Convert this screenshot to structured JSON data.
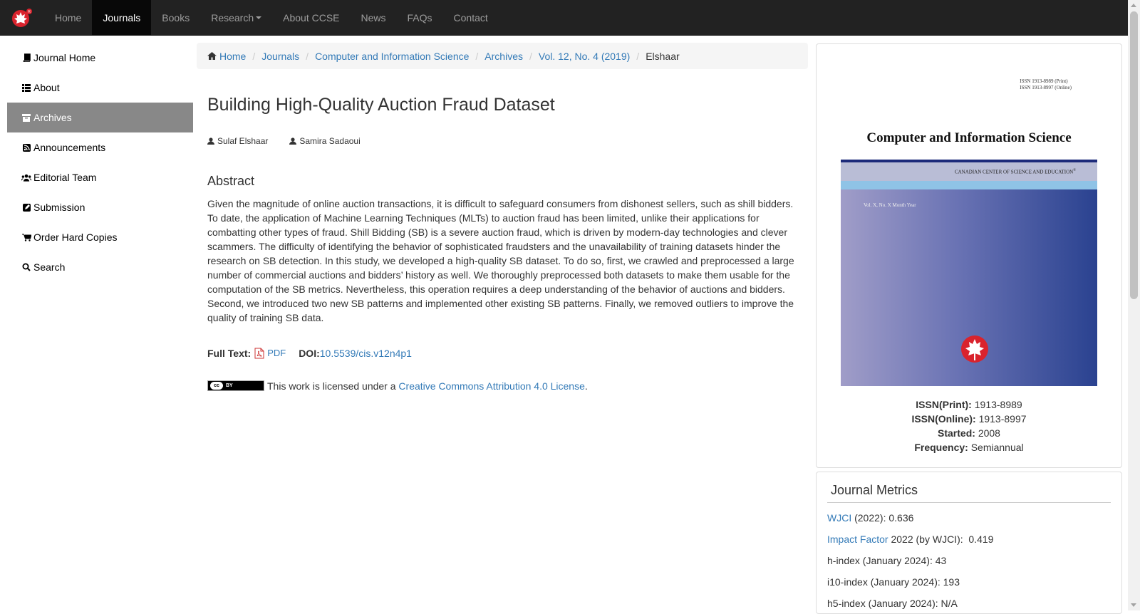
{
  "nav": {
    "items": [
      {
        "label": "Home",
        "active": false
      },
      {
        "label": "Journals",
        "active": true
      },
      {
        "label": "Books",
        "active": false
      },
      {
        "label": "Research",
        "active": false,
        "dropdown": true
      },
      {
        "label": "About CCSE",
        "active": false
      },
      {
        "label": "News",
        "active": false
      },
      {
        "label": "FAQs",
        "active": false
      },
      {
        "label": "Contact",
        "active": false
      }
    ]
  },
  "sidebar": {
    "items": [
      {
        "label": "Journal Home",
        "icon": "book-icon"
      },
      {
        "label": "About",
        "icon": "list-icon"
      },
      {
        "label": "Archives",
        "icon": "archive-icon",
        "active": true
      },
      {
        "label": "Announcements",
        "icon": "rss-icon"
      },
      {
        "label": "Editorial Team",
        "icon": "users-icon"
      },
      {
        "label": "Submission",
        "icon": "edit-icon"
      },
      {
        "label": "Order Hard Copies",
        "icon": "cart-icon"
      },
      {
        "label": "Search",
        "icon": "search-icon"
      }
    ]
  },
  "breadcrumb": {
    "home": "Home",
    "journals": "Journals",
    "journal": "Computer and Information Science",
    "archives": "Archives",
    "issue": "Vol. 12, No. 4 (2019)",
    "current": "Elshaar"
  },
  "article": {
    "title": "Building High-Quality Auction Fraud Dataset",
    "authors": [
      "Sulaf Elshaar",
      "Samira Sadaoui"
    ],
    "abstract_heading": "Abstract",
    "abstract": "Given the magnitude of online auction transactions, it is difficult to safeguard consumers from dishonest sellers, such as shill bidders. To date, the application of Machine Learning Techniques (MLTs) to auction fraud has been limited, unlike their applications for combatting other types of fraud. Shill Bidding (SB) is a severe auction fraud, which is driven by modern-day technologies and clever scammers. The difficulty of identifying the behavior of sophisticated fraudsters and the unavailability of training datasets hinder the research on SB detection. In this study, we developed a high-quality SB dataset. To do so, first, we crawled and preprocessed a large number of commercial auctions and bidders’ history as well. We thoroughly preprocessed both datasets to make them usable for the computation of the SB metrics. Nevertheless, this operation requires a deep understanding of the behavior of auctions and bidders. Second, we introduced two new SB patterns and implemented other existing SB patterns. Finally, we removed outliers to improve the quality of training SB data.",
    "fulltext_label": "Full Text:",
    "pdf_label": "PDF",
    "doi_label": "DOI:",
    "doi_value": "10.5539/cis.v12n4p1",
    "license_prefix": "This work is licensed under a ",
    "license_link": "Creative Commons Attribution 4.0 License",
    "license_suffix": ".",
    "cc_badge_text": "BY"
  },
  "cover": {
    "issn_print_line": "ISSN 1913-8989 (Print)",
    "issn_online_line": "ISSN 1913-8997 (Online)",
    "title": "Computer and Information Science",
    "org": "CANADIAN CENTER OF SCIENCE AND EDUCATION",
    "vol_line": "Vol. X, No. X  Month Year"
  },
  "journal_info": {
    "issn_print_label": "ISSN(Print):",
    "issn_print": "1913-8989",
    "issn_online_label": "ISSN(Online):",
    "issn_online": "1913-8997",
    "started_label": "Started:",
    "started": "2008",
    "frequency_label": "Frequency:",
    "frequency": "Semiannual"
  },
  "metrics": {
    "title": "Journal Metrics",
    "wjci_link": "WJCI",
    "wjci_text": " (2022): 0.636",
    "if_link": "Impact Factor",
    "if_text": " 2022 (by WJCI):  0.419",
    "h_index": "h-index (January 2024): 43",
    "i10_index": "i10-index (January 2024): 193",
    "h5_index": "h5-index (January 2024): N/A"
  },
  "colors": {
    "navbar": "#222222",
    "link": "#337ab7",
    "sidebar_active": "#888888"
  }
}
